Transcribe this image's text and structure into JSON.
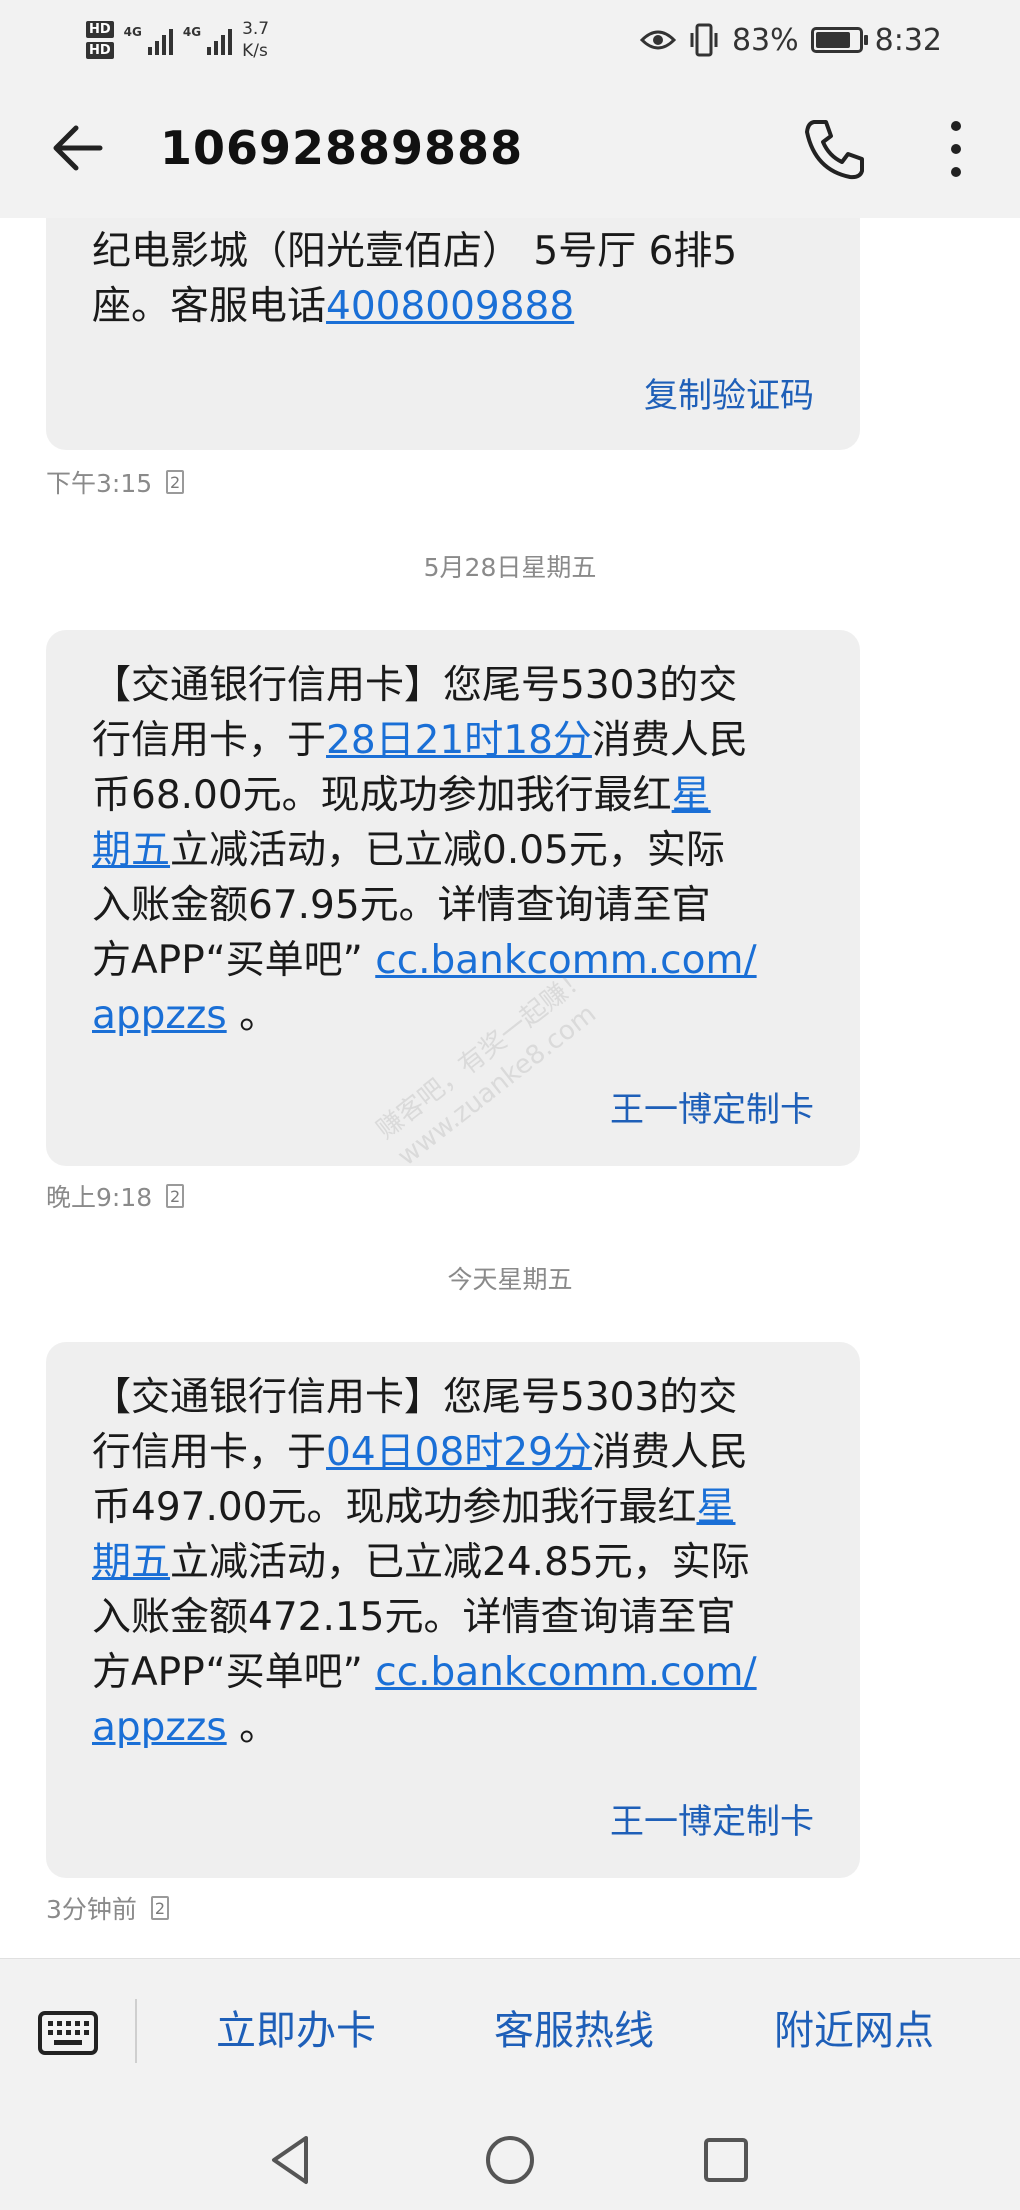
{
  "status_bar": {
    "hd1": "HD",
    "hd2": "HD",
    "net1": "4G",
    "net2": "4G",
    "speed_value": "3.7",
    "speed_unit": "K/s",
    "battery_percent": "83%",
    "battery_level": 0.83,
    "time": "8:32",
    "icons": [
      "eye-icon",
      "vibrate-icon",
      "battery-icon"
    ]
  },
  "app_bar": {
    "title": "10692889888",
    "icons": [
      "back-arrow-icon",
      "phone-icon",
      "more-vert-icon"
    ]
  },
  "messages": [
    {
      "lines": [
        "纪电影城（阳光壹佰店） 5号厅 6排5",
        "座。客服电话"
      ],
      "link_phone": "4008009888",
      "action": "复制验证码",
      "time": "下午3:15",
      "sim": "2"
    },
    {
      "date_header": "5月28日星期五",
      "parts": {
        "p1": "【交通银行信用卡】您尾号5303的交\n行信用卡，于",
        "l1": "28日21时18分",
        "p2": "消费人民\n币68.00元。现成功参加我行最红",
        "l2": "星\n期五",
        "p3": "立减活动，已立减0.05元，实际\n入账金额67.95元。详情查询请至官\n方APP“买单吧” ",
        "l3": "cc.bankcomm.com/\nappzzs",
        "p4": " 。"
      },
      "action": "王一博定制卡",
      "time": "晚上9:18",
      "sim": "2"
    },
    {
      "date_header": "今天星期五",
      "parts": {
        "p1": "【交通银行信用卡】您尾号5303的交\n行信用卡，于",
        "l1": "04日08时29分",
        "p2": "消费人民\n币497.00元。现成功参加我行最红",
        "l2": "星\n期五",
        "p3": "立减活动，已立减24.85元，实际\n入账金额472.15元。详情查询请至官\n方APP“买单吧” ",
        "l3": "cc.bankcomm.com/\nappzzs",
        "p4": " 。"
      },
      "action": "王一博定制卡",
      "time": "3分钟前",
      "sim": "2"
    }
  ],
  "bottom_menu": {
    "items": [
      "立即办卡",
      "客服热线",
      "附近网点"
    ],
    "icons": [
      "keyboard-icon"
    ]
  },
  "nav_bar": {
    "icons": [
      "nav-back-icon",
      "nav-home-icon",
      "nav-recents-icon"
    ]
  },
  "watermark": {
    "line1": "赚客吧，有奖一起赚！",
    "line2": "www.zuanke8.com"
  },
  "colors": {
    "link": "#1a6fd6",
    "action": "#1e5fb8",
    "bubble": "#efefef",
    "bar_bg": "#f2f2f2"
  }
}
